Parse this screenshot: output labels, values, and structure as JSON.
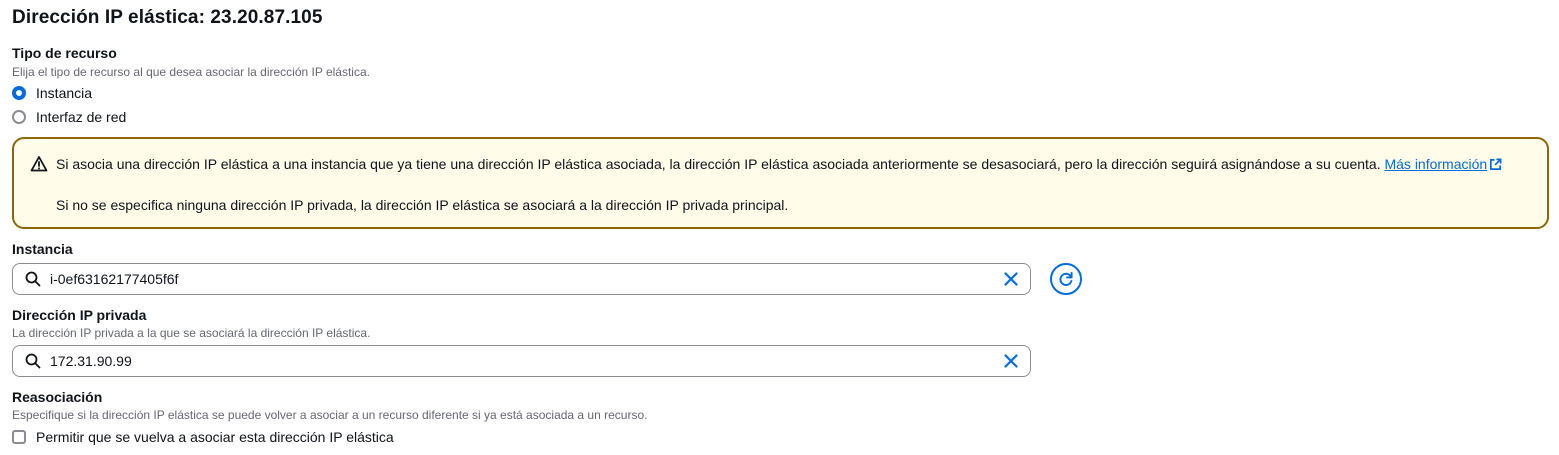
{
  "page": {
    "title": "Dirección IP elástica: 23.20.87.105"
  },
  "resource_type": {
    "label": "Tipo de recurso",
    "description": "Elija el tipo de recurso al que desea asociar la dirección IP elástica.",
    "options": [
      {
        "label": "Instancia",
        "selected": true
      },
      {
        "label": "Interfaz de red",
        "selected": false
      }
    ]
  },
  "alert": {
    "type": "warning",
    "line1": "Si asocia una dirección IP elástica a una instancia que ya tiene una dirección IP elástica asociada, la dirección IP elástica asociada anteriormente se desasociará, pero la dirección seguirá asignándose a su cuenta.",
    "link_label": "Más información",
    "line2": "Si no se especifica ninguna dirección IP privada, la dirección IP elástica se asociará a la dirección IP privada principal."
  },
  "instance": {
    "label": "Instancia",
    "value": "i-0ef63162177405f6f"
  },
  "private_ip": {
    "label": "Dirección IP privada",
    "description": "La dirección IP privada a la que se asociará la dirección IP elástica.",
    "value": "172.31.90.99"
  },
  "reassociation": {
    "label": "Reasociación",
    "description": "Especifique si la dirección IP elástica se puede volver a asociar a un recurso diferente si ya está asociada a un recurso.",
    "checkbox_label": "Permitir que se vuelva a asociar esta dirección IP elástica",
    "checked": false
  },
  "colors": {
    "accent": "#006ce0",
    "warning_border": "#8d6605",
    "warning_bg": "#fffce9",
    "text": "#0f141a",
    "secondary_text": "#656871"
  },
  "icons": {
    "alert": "warning-icon",
    "search": "search-icon",
    "clear": "close-icon",
    "refresh": "refresh-icon",
    "external": "external-link-icon"
  }
}
